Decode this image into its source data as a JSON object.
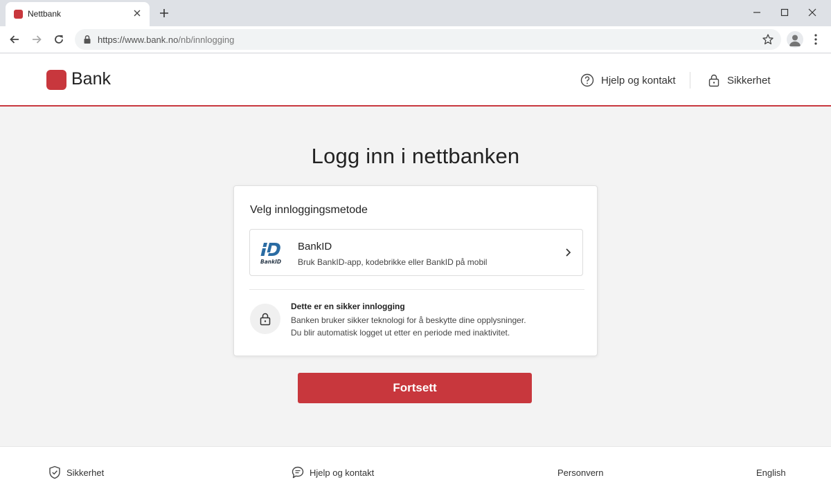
{
  "browser": {
    "tab_title": "Nettbank",
    "url_scheme": "https://",
    "url_host": "www.bank.no",
    "url_path": "/nb/innlogging"
  },
  "header": {
    "logo_text": "Bank",
    "help_label": "Hjelp og kontakt",
    "security_label": "Sikkerhet"
  },
  "main": {
    "title": "Logg inn i nettbanken",
    "card_heading": "Velg innloggingsmetode",
    "method": {
      "logo_label": "BankID",
      "title": "BankID",
      "description": "Bruk BankID-app, kodebrikke eller BankID på mobil"
    },
    "secure": {
      "title": "Dette er en sikker innlogging",
      "line1": "Banken bruker sikker teknologi for å beskytte dine opplysninger.",
      "line2": "Du blir automatisk logget ut etter en periode med inaktivitet."
    },
    "continue_label": "Fortsett"
  },
  "footer": {
    "security": "Sikkerhet",
    "help": "Hjelp og kontakt",
    "privacy": "Personvern",
    "language": "English"
  },
  "colors": {
    "brand": "#c8373d",
    "bankid_blue": "#2b6ca3"
  },
  "icons": {
    "back": "arrow-left-icon",
    "forward": "arrow-right-icon",
    "reload": "reload-icon",
    "help": "question-circle-icon",
    "lock": "lock-icon",
    "shield": "shield-check-icon",
    "chat": "chat-bubble-icon",
    "chevron": "chevron-right-icon"
  }
}
